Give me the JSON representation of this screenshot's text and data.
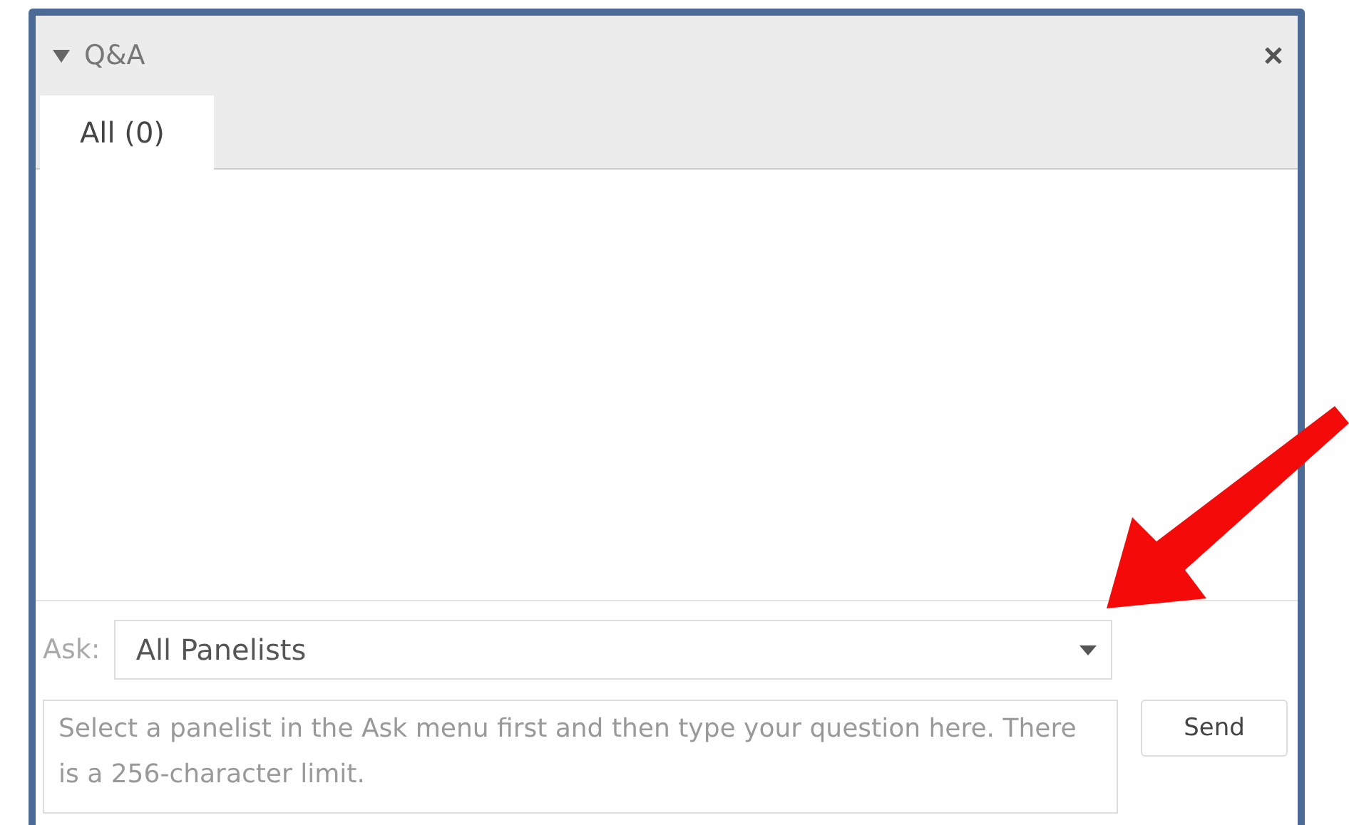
{
  "panel": {
    "title": "Q&A",
    "expanded": true
  },
  "tabs": [
    {
      "label": "All (0)",
      "selected": true
    }
  ],
  "ask": {
    "label": "Ask:",
    "value": "All Panelists"
  },
  "question": {
    "placeholder": "Select a panelist in the Ask menu first and then type your question here. There is a 256-character limit."
  },
  "buttons": [
    "Send"
  ]
}
